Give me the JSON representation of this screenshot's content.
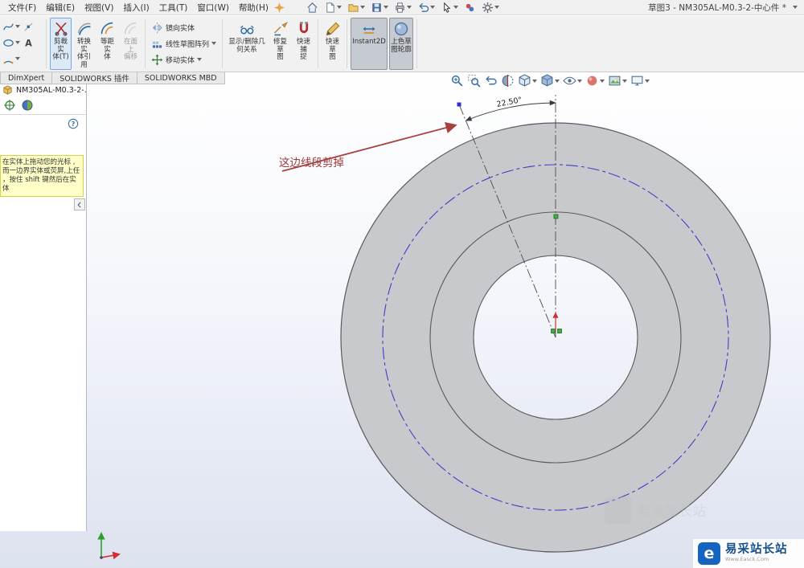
{
  "menubar": {
    "menus": [
      {
        "label": "文件(F)"
      },
      {
        "label": "编辑(E)"
      },
      {
        "label": "视图(V)"
      },
      {
        "label": "插入(I)"
      },
      {
        "label": "工具(T)"
      },
      {
        "label": "窗口(W)"
      },
      {
        "label": "帮助(H)"
      }
    ],
    "toolbar_icons": [
      {
        "icon": "home"
      },
      {
        "icon": "new-document"
      },
      {
        "icon": "open-folder"
      },
      {
        "icon": "save"
      },
      {
        "icon": "print"
      },
      {
        "icon": "undo"
      },
      {
        "icon": "select-cursor"
      },
      {
        "icon": "appearance-beads"
      },
      {
        "icon": "options-gear"
      }
    ],
    "title": "草图3 - NM305AL-M0.3-2-中心件 *"
  },
  "ribbon": {
    "sketch_tools": [
      {
        "icon": "spline"
      },
      {
        "icon": "point-tool"
      },
      {
        "icon": "ellipse-tool"
      },
      {
        "icon": "text-a"
      },
      {
        "icon": "arc-tool"
      }
    ],
    "big_buttons": [
      {
        "icon": "trim",
        "line1": "剪裁实",
        "line2": "体(T)",
        "state": "selected"
      },
      {
        "icon": "convert-entities",
        "line1": "转换实",
        "line2": "体引用",
        "state": "normal"
      },
      {
        "icon": "offset-entities",
        "line1": "等距实",
        "line2": "体",
        "state": "normal"
      },
      {
        "icon": "offset-on-face",
        "line1": "在面上",
        "line2": "偏移",
        "state": "disabled"
      }
    ],
    "row_buttons": [
      {
        "icon": "mirror",
        "label": "镜向实体"
      },
      {
        "icon": "linear-pattern",
        "label": "线性草图阵列"
      },
      {
        "icon": "move",
        "label": "移动实体"
      }
    ],
    "right_buttons": [
      {
        "icon": "display-relations",
        "line1": "显示/删除几",
        "line2": "何关系",
        "state": "normal"
      },
      {
        "icon": "repair-sketch",
        "line1": "修复草",
        "line2": "图",
        "state": "normal"
      },
      {
        "icon": "quick-snaps",
        "line1": "快速捕",
        "line2": "捉",
        "state": "normal"
      },
      {
        "icon": "rapid-sketch",
        "line1": "快速草",
        "line2": "图",
        "state": "normal"
      },
      {
        "icon": "instant2d",
        "line1": "Instant2D",
        "line2": "",
        "state": "pressed"
      },
      {
        "icon": "shaded-contours",
        "line1": "上色草",
        "line2": "图轮廓",
        "state": "pressed"
      }
    ]
  },
  "tabs": [
    {
      "label": "DimXpert"
    },
    {
      "label": "SOLIDWORKS 插件"
    },
    {
      "label": "SOLIDWORKS MBD"
    }
  ],
  "panel": {
    "tree_root": "NM305AL-M0.3-2-...",
    "tab_icons": [
      {
        "icon": "target"
      },
      {
        "icon": "display-sphere"
      }
    ],
    "tooltip_lines": [
      "在实体上拖动您的光标 ,",
      "而一边界实体或荧屏,上任",
      "，按住 shift 键然后在实体"
    ]
  },
  "headsup": [
    {
      "icon": "zoom-fit"
    },
    {
      "icon": "zoom-area"
    },
    {
      "icon": "previous-view"
    },
    {
      "icon": "section-view"
    },
    {
      "icon": "view-orientation"
    },
    {
      "icon": "display-style"
    },
    {
      "icon": "hide-show"
    },
    {
      "icon": "edit-appearance"
    },
    {
      "icon": "apply-scene"
    },
    {
      "icon": "view-settings"
    }
  ],
  "viewport": {
    "dimension_label": "22.50°",
    "annotation": "这边线段剪掉"
  },
  "watermark": {
    "name": "易采站长站",
    "tagline": "Www.Easck.Com",
    "logo_letter": "e"
  }
}
